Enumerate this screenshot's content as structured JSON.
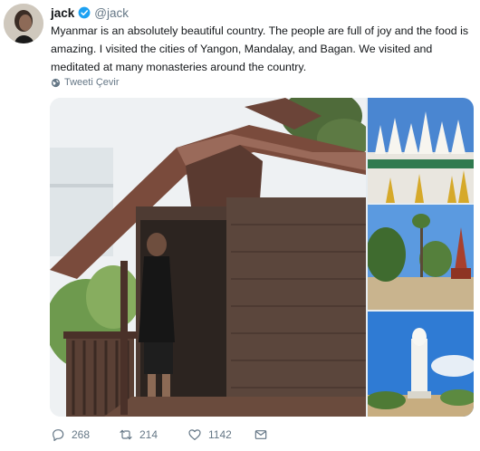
{
  "tweet": {
    "display_name": "jack",
    "handle": "@jack",
    "verified": true,
    "text": "Myanmar is an absolutely beautiful country. The people are full of joy and the food is amazing. I visited the cities of Yangon, Mandalay, and Bagan. We visited and meditated at many monasteries around the country.",
    "translate_label": "Tweeti Çevir"
  },
  "actions": {
    "replies": "268",
    "retweets": "214",
    "likes": "1142"
  },
  "colors": {
    "secondary_text": "#657786",
    "verified_blue": "#1da1f2",
    "primary_text": "#14171a"
  },
  "icons": {
    "verified": "verified-badge-icon",
    "translate": "globe-icon",
    "reply": "reply-icon",
    "retweet": "retweet-icon",
    "like": "heart-icon",
    "message": "mail-icon"
  }
}
